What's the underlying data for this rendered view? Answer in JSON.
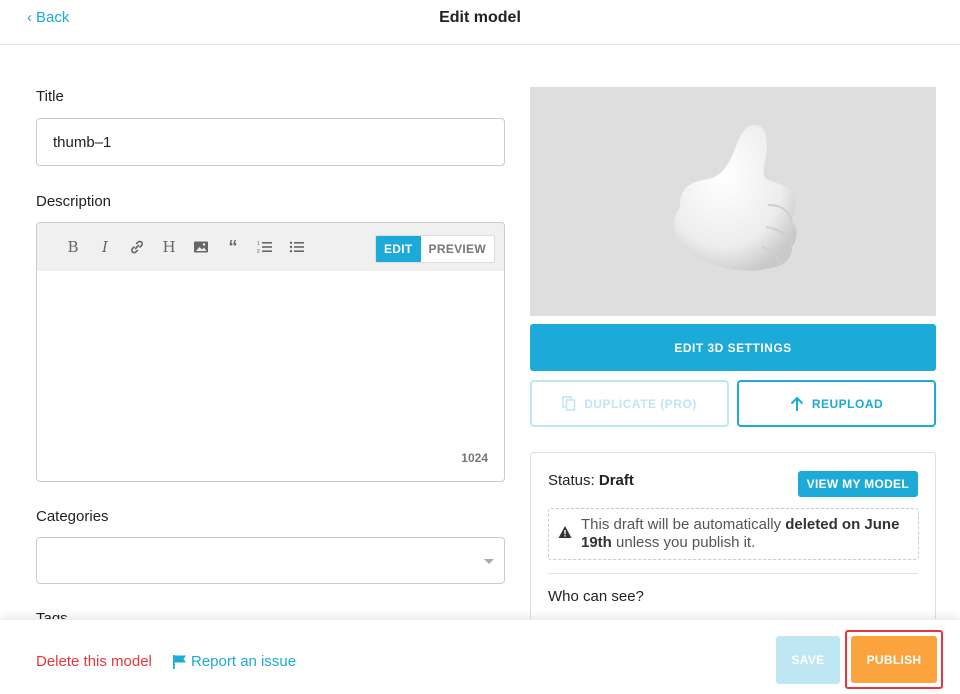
{
  "header": {
    "back_label": "Back",
    "title": "Edit model"
  },
  "form": {
    "title_label": "Title",
    "title_value": "thumb–1",
    "description_label": "Description",
    "editor_tabs": [
      "EDIT",
      "PREVIEW"
    ],
    "char_count": "1024",
    "categories_label": "Categories",
    "tags_label": "Tags"
  },
  "toolbar_icons": [
    "bold-icon",
    "italic-icon",
    "link-icon",
    "heading-icon",
    "image-icon",
    "quote-icon",
    "ordered-list-icon",
    "bullet-list-icon"
  ],
  "side": {
    "edit_3d_label": "EDIT 3D SETTINGS",
    "duplicate_label": "DUPLICATE (PRO)",
    "reupload_label": "REUPLOAD",
    "status_label": "Status:",
    "status_value": "Draft",
    "view_model_label": "VIEW MY MODEL",
    "notice_prefix": "This draft will be automatically ",
    "notice_bold": "deleted on June 19th",
    "notice_suffix": " unless you publish it.",
    "who_label": "Who can see?"
  },
  "footer": {
    "delete_label": "Delete this model",
    "report_label": "Report an issue",
    "save_label": "SAVE",
    "publish_label": "PUBLISH"
  },
  "colors": {
    "accent": "#1caad9",
    "danger": "#e8363c",
    "publish": "#fba43e"
  }
}
